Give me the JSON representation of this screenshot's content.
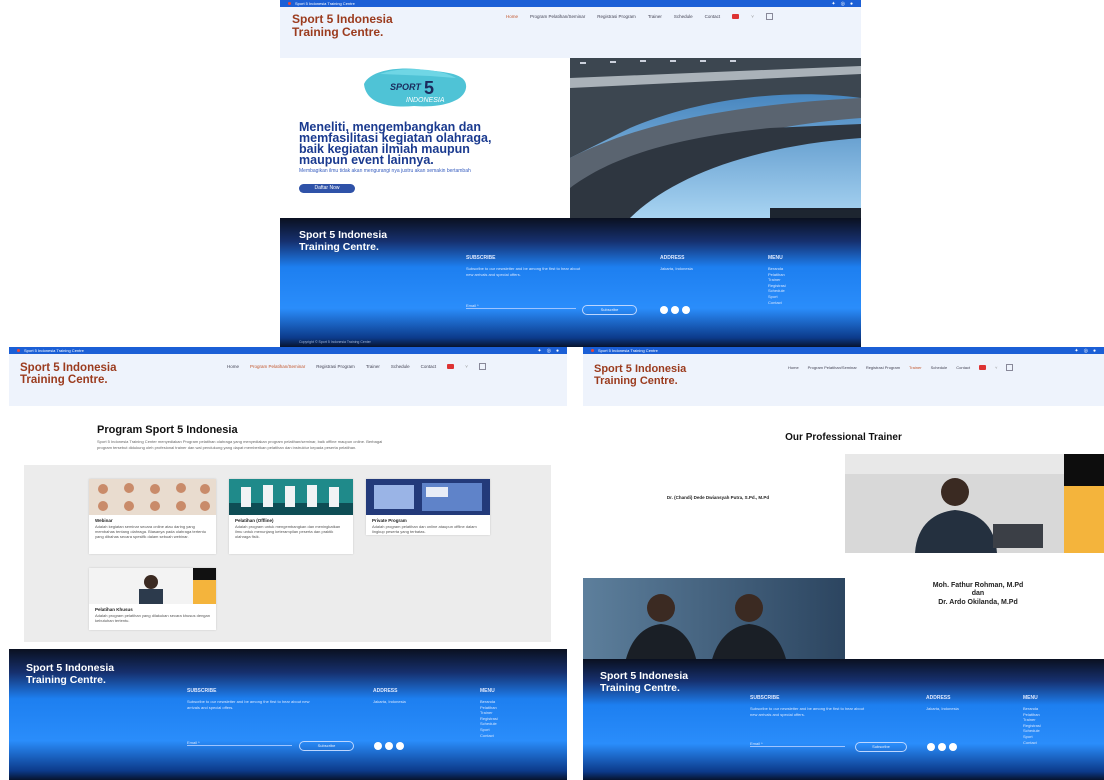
{
  "site": {
    "topbar_text": "Sport 5 Indonesia Training Centre",
    "brand_line1": "Sport 5 Indonesia",
    "brand_line2": "Training Centre.",
    "nav": [
      "Home",
      "Program Pelatihan/Seminar",
      "Registrasi Program",
      "Trainer",
      "Schedule",
      "Contact"
    ],
    "social_icons": [
      "twitter-icon",
      "instagram-icon",
      "facebook-icon"
    ]
  },
  "home": {
    "logo_word_top": "SPORT",
    "logo_number": "5",
    "logo_word_bottom": "INDONESIA",
    "headline": "Meneliti, mengembangkan dan memfasilitasi kegiatan olahraga, baik kegiatan ilmiah maupun maupun event lainnya.",
    "subtext": "Membagikan ilmu tidak akan mengurangi nya justru akan semakin bertambah",
    "cta": "Daftar Now"
  },
  "footer": {
    "subscribe_title": "SUBSCRIBE",
    "subscribe_text": "Subscribe to our newsletter and be among the first to hear about new arrivals and special offers.",
    "email_placeholder": "Email *",
    "subscribe_button": "Subscribe",
    "address_title": "ADDRESS",
    "address_text": "Jakarta, Indonesia",
    "menu_title": "MENU",
    "menu_items": [
      "Beranda",
      "Pelatihan",
      "Trainer",
      "Registrasi",
      "Schedule",
      "Sport",
      "Contact"
    ],
    "copyright": "Copyright © Sport 5 Indonesia Training Center"
  },
  "programs": {
    "title": "Program Sport 5 Indonesia",
    "description": "Sport 5 Indonesia Training Center menyediakan Program pelatihan olahraga yang menyediakan program pelatihan/seminar, baik offline maupun online. Berbagai program tersebut didukung oleh profesional trainer dan wal pendukung yang dapat memberikan pelatihan dan instruktur kepada peserta pelatihan.",
    "cards": [
      {
        "title": "Webinar",
        "text": "Adalah kegiatan seminar secara online atau daring yang membahas tentang olahraga. Biasanya pada olahraga tertentu yang dibahas secara spesifik dalam sebuah webinar."
      },
      {
        "title": "Pelatihan (Offline)",
        "text": "Adalah program untuk mengembangkan dan meningkatkan ilmu untuk menunjang keterampilan peserta dan praktik olahraga fisik."
      },
      {
        "title": "Private Program",
        "text": "Adalah program pelatihan dan online ataupun offline dalam lingkup peserta yang terbatas."
      },
      {
        "title": "Pelatihan Khusus",
        "text": "Adalah program pelatihan yang dilakukan secara khusus dengan kebutuhan tertentu."
      }
    ]
  },
  "trainers": {
    "title": "Our Professional Trainer",
    "trainer1": "Dr. (Chandi) Dede Dwiansyah Putra, S.Pd., M.Pd",
    "trainer2_line1": "Moh. Fathur Rohman, M.Pd",
    "trainer2_line2": "dan",
    "trainer2_line3": "Dr. Ardo Okilanda, M.Pd"
  },
  "colors": {
    "topbar": "#1b5fd6",
    "brand": "#9b3b1e",
    "nav_active": "#c2562c",
    "headline": "#1a3a8f",
    "cta": "#2f52a8"
  }
}
